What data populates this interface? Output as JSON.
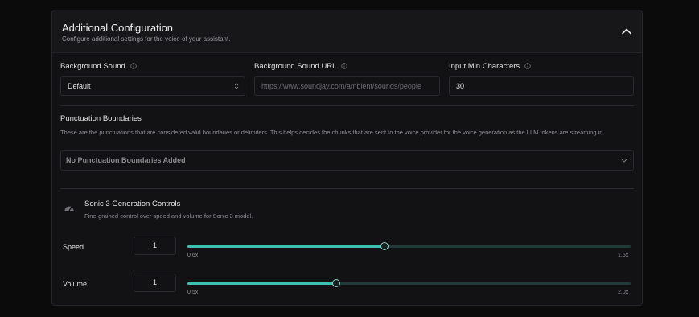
{
  "panel": {
    "title": "Additional Configuration",
    "subtitle": "Configure additional settings for the voice of your assistant."
  },
  "fields": {
    "background_sound": {
      "label": "Background Sound",
      "value": "Default"
    },
    "background_sound_url": {
      "label": "Background Sound URL",
      "placeholder": "https://www.soundjay.com/ambient/sounds/people"
    },
    "input_min_characters": {
      "label": "Input Min Characters",
      "value": "30"
    }
  },
  "punctuation": {
    "label": "Punctuation Boundaries",
    "description": "These are the punctuations that are considered valid boundaries or delimiters. This helps decides the chunks that are sent to the voice provider for the voice generation as the LLM tokens are streaming in.",
    "selected": "No Punctuation Boundaries Added"
  },
  "sonic": {
    "title": "Sonic 3 Generation Controls",
    "subtitle": "Fine-grained control over speed and volume for Sonic 3 model.",
    "speed": {
      "label": "Speed",
      "value": "1",
      "min_label": "0.6x",
      "max_label": "1.5x",
      "fraction": 0.445
    },
    "volume": {
      "label": "Volume",
      "value": "1",
      "min_label": "0.5x",
      "max_label": "2.0x",
      "fraction": 0.335
    }
  },
  "colors": {
    "accent": "#3cbfb0",
    "track": "#1f3a38",
    "panel": "#121214"
  }
}
